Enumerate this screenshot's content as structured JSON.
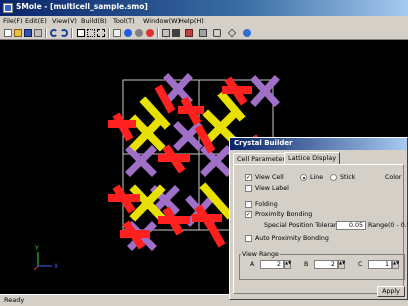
{
  "window": {
    "title": "SMole - [multicell_sample.smo]"
  },
  "menu": [
    "File(F)",
    "Edit(E)",
    "View(V)",
    "Build(B)",
    "Tool(T)",
    "Window(W)",
    "Help(H)"
  ],
  "toolbar_icons": [
    "new-file-icon",
    "open-folder-icon",
    "save-icon",
    "print-icon",
    "undo-icon",
    "redo-icon",
    "select-icon",
    "select-dotted-icon",
    "select-box-icon",
    "atom-cross-icon",
    "atom-blue-icon",
    "atom-gray-icon",
    "atom-red-icon",
    "measure-icon",
    "camera-icon",
    "printer-icon",
    "display-icon",
    "chain-icon",
    "diamond-icon",
    "info-icon"
  ],
  "status": "Ready",
  "dialog": {
    "title": "Crystal Builder",
    "tabs": [
      "Cell Parameter",
      "Lattice Display"
    ],
    "view_cell": "View Cell",
    "line": "Line",
    "stick": "Stick",
    "color": "Color",
    "view_label": "View Label",
    "folding": "Folding",
    "proximity_bonding": "Proximity Bonding",
    "tolerance_label": "Special Position Tolerance:",
    "tolerance_value": "0.05",
    "tolerance_range": "Range(0 - 0.5)",
    "auto_proximity_bonding": "Auto Proximity Bonding",
    "view_range": "View Range",
    "range_a_label": "A",
    "range_a_value": "2",
    "range_b_label": "B",
    "range_b_value": "2",
    "range_c_label": "C",
    "range_c_value": "1",
    "apply": "Apply",
    "checked": {
      "view_cell": true,
      "view_label": false,
      "folding": false,
      "proximity_bonding": true,
      "auto_proximity_bonding": false
    },
    "display_mode": "Line"
  },
  "axis_labels": {
    "y": "Y",
    "x": "X"
  },
  "colors": {
    "oxygen": "#ff2020",
    "silicon": "#e8e000",
    "aluminium": "#a070c8",
    "cell_line": "#c8c8c8"
  }
}
